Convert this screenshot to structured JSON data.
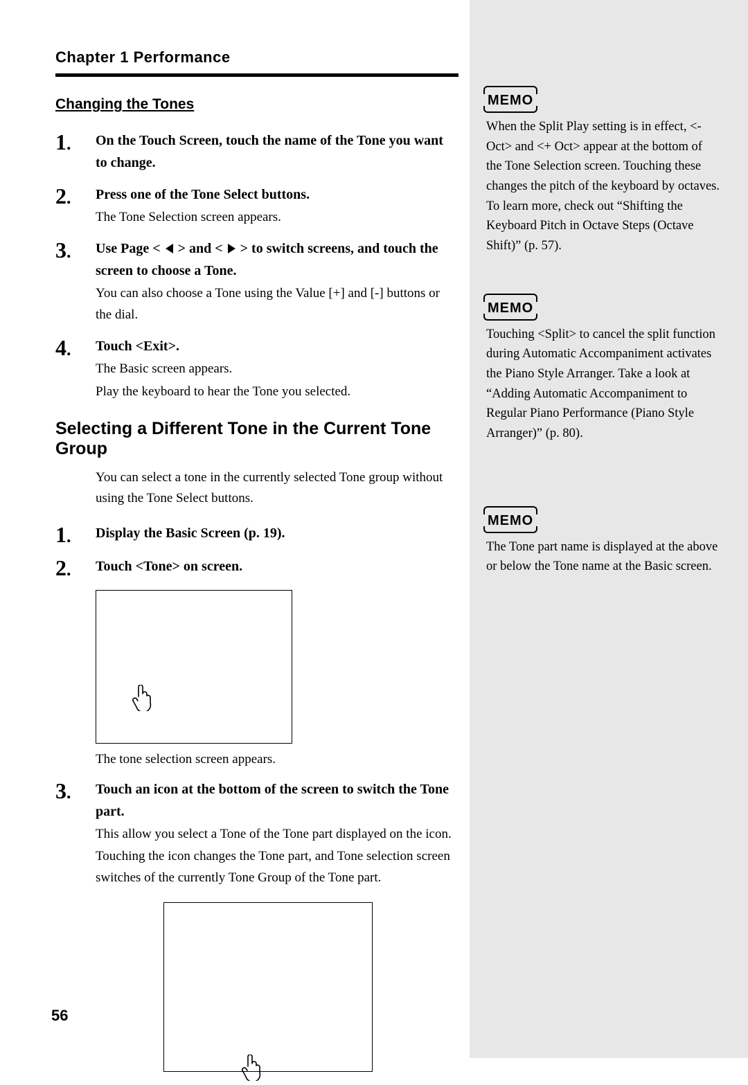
{
  "chapter_title": "Chapter 1 Performance",
  "section_title": "Changing the Tones",
  "steps_a": [
    {
      "num": "1",
      "bold": "On the Touch Screen, touch the name of the Tone you want to change.",
      "plain": ""
    },
    {
      "num": "2",
      "bold": "Press one of the Tone Select buttons.",
      "plain": "The Tone Selection screen appears."
    },
    {
      "num": "3",
      "bold_before": "Use Page < ",
      "bold_mid": " > and < ",
      "bold_after": " > to switch screens, and touch the screen to choose a Tone.",
      "plain": "You can also choose a Tone using the Value [+] and [-] buttons or the dial."
    },
    {
      "num": "4",
      "bold": "Touch <Exit>.",
      "plain": "The Basic screen appears.",
      "plain2": "Play the keyboard to hear the Tone you selected."
    }
  ],
  "subheading": "Selecting a Different Tone in the Current Tone Group",
  "intro": "You can select a tone in the currently selected Tone group without using the Tone Select buttons.",
  "steps_b": [
    {
      "num": "1",
      "bold": "Display the Basic Screen (p. 19)."
    },
    {
      "num": "2",
      "bold": "Touch <Tone> on screen."
    }
  ],
  "caption1": "The tone selection screen appears.",
  "step_b3": {
    "num": "3",
    "bold": "Touch an icon at the bottom of the screen to switch the Tone part.",
    "plain1": "This allow you select a Tone of the Tone part displayed on the icon.",
    "plain2": "Touching the icon changes the Tone part, and Tone selection screen switches of the currently Tone Group of the Tone part."
  },
  "memo_label": "MEMO",
  "memo1": "When the Split Play setting is in effect, <- Oct> and <+ Oct> appear at the bottom of the Tone Selection screen. Touching these changes the pitch of the keyboard by octaves. To learn more, check out “Shifting the Keyboard Pitch in Octave Steps (Octave Shift)” (p. 57).",
  "memo2": "Touching <Split> to cancel the split function during Automatic Accompaniment activates the Piano Style Arranger. Take a look at “Adding Automatic Accompaniment to Regular Piano Performance (Piano Style Arranger)” (p. 80).",
  "memo3": "The Tone part name is displayed at the above or below the Tone name at the Basic screen.",
  "page_number": "56"
}
